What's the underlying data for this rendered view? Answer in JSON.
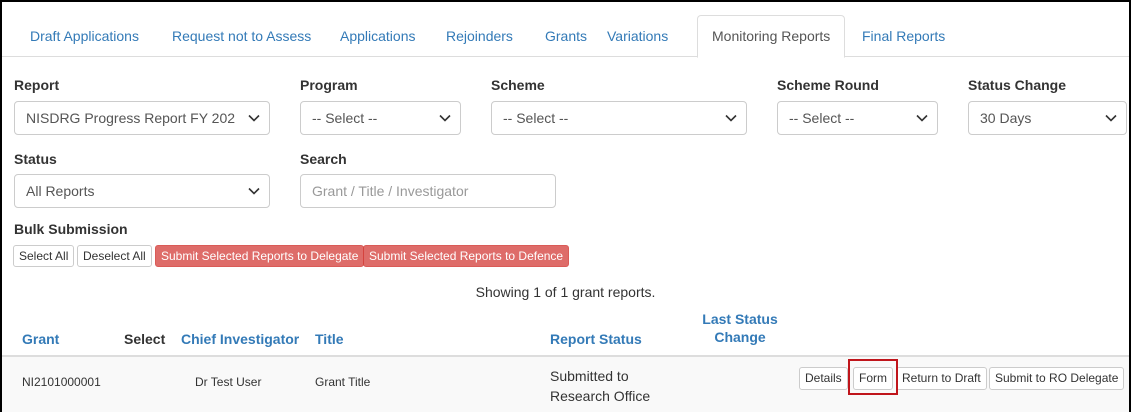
{
  "tabs": [
    {
      "label": "Draft Applications"
    },
    {
      "label": "Request not to Assess"
    },
    {
      "label": "Applications"
    },
    {
      "label": "Rejoinders"
    },
    {
      "label": "Grants"
    },
    {
      "label": "Variations"
    },
    {
      "label": "Monitoring Reports",
      "active": true
    },
    {
      "label": "Final Reports"
    }
  ],
  "filters": {
    "report": {
      "label": "Report",
      "value": "NISDRG Progress Report FY 202"
    },
    "program": {
      "label": "Program",
      "value": "-- Select --"
    },
    "scheme": {
      "label": "Scheme",
      "value": "-- Select --"
    },
    "scheme_round": {
      "label": "Scheme Round",
      "value": "-- Select --"
    },
    "status_change": {
      "label": "Status Change",
      "value": "30 Days"
    },
    "status": {
      "label": "Status",
      "value": "All Reports"
    },
    "search": {
      "label": "Search",
      "placeholder": "Grant / Title / Investigator"
    }
  },
  "bulk": {
    "label": "Bulk Submission",
    "select_all": "Select All",
    "deselect_all": "Deselect All",
    "submit_delegate": "Submit Selected Reports to Delegate",
    "submit_defence": "Submit Selected Reports to Defence"
  },
  "summary": "Showing 1 of 1 grant reports.",
  "table": {
    "headers": {
      "grant": "Grant",
      "select": "Select",
      "chief_investigator": "Chief Investigator",
      "title": "Title",
      "report_status": "Report Status",
      "last_status_change_1": "Last Status",
      "last_status_change_2": "Change"
    },
    "rows": [
      {
        "grant": "NI2101000001",
        "chief_investigator": "Dr Test User",
        "title": "Grant Title",
        "report_status_1": "Submitted to",
        "report_status_2": "Research Office",
        "actions": {
          "details": "Details",
          "form": "Form",
          "return_to_draft": "Return to Draft",
          "submit_to_ro_delegate": "Submit to RO Delegate"
        }
      }
    ]
  },
  "colors": {
    "link": "#337ab7",
    "danger": "#d9534f",
    "highlight": "#c0151b"
  }
}
